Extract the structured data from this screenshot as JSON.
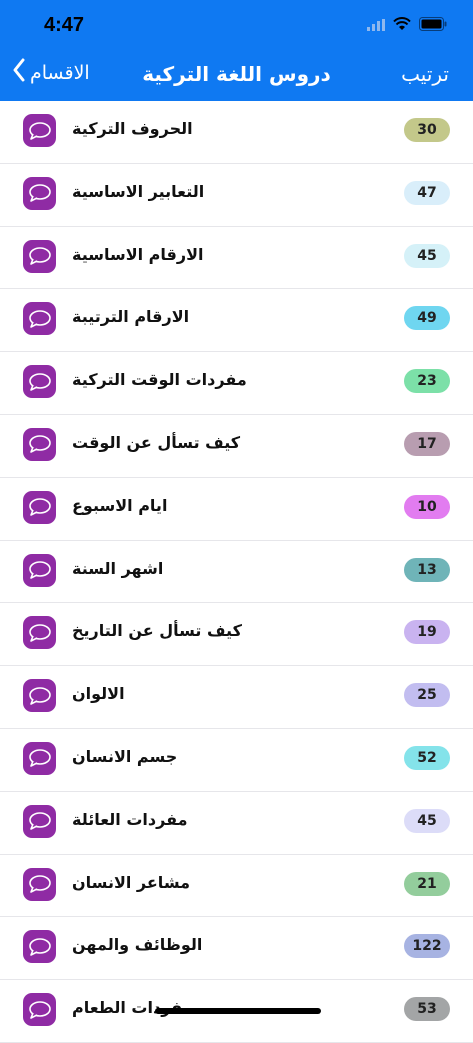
{
  "status_bar": {
    "time": "4:47"
  },
  "nav": {
    "back_label": "الاقسام",
    "title": "دروس اللغة التركية",
    "right_label": "ترتيب"
  },
  "items": [
    {
      "label": "الحروف التركية",
      "count": "30",
      "color": "#c3c88a"
    },
    {
      "label": "التعابير الاساسية",
      "count": "47",
      "color": "#d9eefa"
    },
    {
      "label": "الارقام الاساسية",
      "count": "45",
      "color": "#d5f1f8"
    },
    {
      "label": "الارقام الترتيبة",
      "count": "49",
      "color": "#6fd6f0"
    },
    {
      "label": "مفردات الوقت التركية",
      "count": "23",
      "color": "#7ce0a8"
    },
    {
      "label": "كيف تسأل عن الوقت",
      "count": "17",
      "color": "#b89db0"
    },
    {
      "label": "ايام الاسبوع",
      "count": "10",
      "color": "#e27cf0"
    },
    {
      "label": "اشهر السنة",
      "count": "13",
      "color": "#6fb4b8"
    },
    {
      "label": "كيف تسأل عن التاريخ",
      "count": "19",
      "color": "#c9b3f0"
    },
    {
      "label": "الالوان",
      "count": "25",
      "color": "#c2bdf0"
    },
    {
      "label": "جسم الانسان",
      "count": "52",
      "color": "#84e3ea"
    },
    {
      "label": "مفردات العائلة",
      "count": "45",
      "color": "#dcdcf8"
    },
    {
      "label": "مشاعر الانسان",
      "count": "21",
      "color": "#93cd9c"
    },
    {
      "label": "الوظائف والمهن",
      "count": "122",
      "color": "#a7b3e2"
    },
    {
      "label": "مفردات الطعام",
      "count": "53",
      "color": "#a3a5a6"
    }
  ]
}
